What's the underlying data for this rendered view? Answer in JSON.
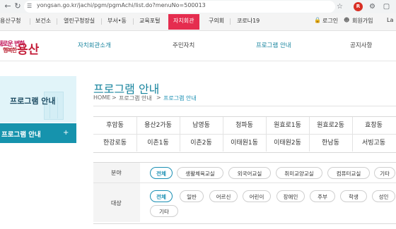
{
  "browser": {
    "url": "yongsan.go.kr/jachi/pgm/pgmAchi/list.do?menuNo=500013"
  },
  "govbar": {
    "items": [
      "용산구청",
      "보건소",
      "열린구청장실",
      "부서•동",
      "교육포털",
      "자치회관",
      "구의회",
      "코로나19"
    ],
    "active": "자치회관",
    "login": "로그인",
    "join": "회원가입",
    "lang": "La"
  },
  "header": {
    "logo_line1": "새로운 변화",
    "logo_line2": "행복한",
    "logo_main": "용산",
    "nav": [
      "자치회관소개",
      "주민자치",
      "프로그램 안내",
      "공지사항"
    ]
  },
  "sidebar": {
    "title": "프로그램 안내",
    "active_item": "프로그램 안내",
    "plus": "+"
  },
  "content": {
    "title": "프로그램 안내",
    "breadcrumb": [
      "HOME",
      "프로그램 안내",
      "프로그램 안내"
    ],
    "dongs_row1": [
      "후암동",
      "용산2가동",
      "남영동",
      "청파동",
      "원효로1동",
      "원효로2동",
      "효창동"
    ],
    "dongs_row2": [
      "한강로동",
      "이촌1동",
      "이촌2동",
      "이태원1동",
      "이태원2동",
      "한남동",
      "서빙고동"
    ],
    "filter": {
      "field_label": "분야",
      "target_label": "대상",
      "fields": [
        "전체",
        "생활체육교실",
        "외국어교실",
        "취미교양교실",
        "컴퓨터교실",
        "기타"
      ],
      "targets": [
        "전체",
        "일반",
        "어르신",
        "어린이",
        "장애인",
        "주부",
        "학생",
        "성인",
        "기타"
      ]
    }
  },
  "colors": {
    "accent": "#1693ad",
    "brand_red": "#e52d4f"
  }
}
